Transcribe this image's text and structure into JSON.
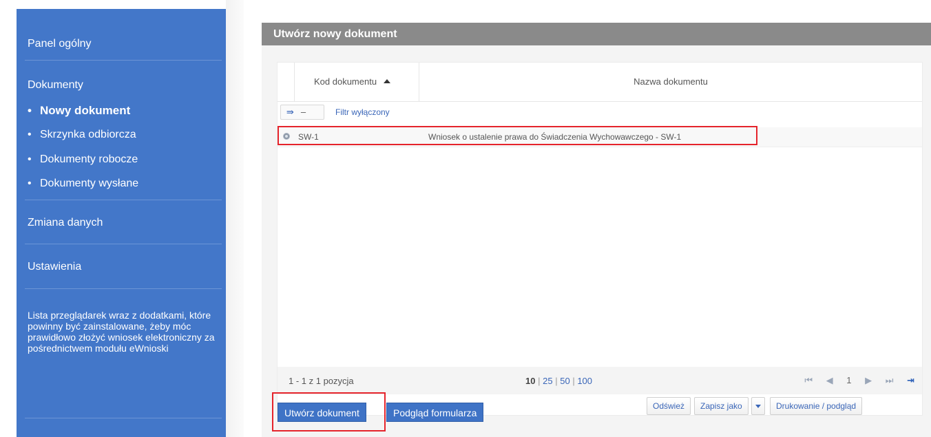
{
  "sidebar": {
    "panel": "Panel ogólny",
    "documents": "Dokumenty",
    "sub_items": [
      {
        "label": "Nowy dokument"
      },
      {
        "label": "Skrzynka odbiorcza"
      },
      {
        "label": "Dokumenty robocze"
      },
      {
        "label": "Dokumenty wysłane"
      }
    ],
    "bullet": "•",
    "change": "Zmiana danych",
    "settings": "Ustawienia",
    "note": "Lista przeglądarek wraz z dodatkami, które powinny być zainstalowane, żeby móc prawidłowo złożyć wniosek elektroniczny za pośrednictwem modułu eWnioski"
  },
  "panel": {
    "title": "Utwórz nowy dokument",
    "columns": {
      "code": "Kod dokumentu",
      "name": "Nazwa dokumentu"
    },
    "filter": {
      "icon": "⇛",
      "minus": "–",
      "status": "Filtr wyłączony"
    },
    "rows": [
      {
        "code": "SW-1",
        "name": "Wniosek o ustalenie prawa do Świadczenia Wychowawczego - SW-1"
      }
    ],
    "pager": {
      "info": "1 - 1 z 1 pozycja",
      "sizes": [
        "10",
        "25",
        "50",
        "100"
      ],
      "sep": "|",
      "first": "⏮",
      "prev": "◀",
      "page": "1",
      "next": "▶",
      "last_btn": "⏭",
      "end": "⇥"
    },
    "toolbar": {
      "refresh": "Odśwież",
      "save_as": "Zapisz jako",
      "print": "Drukowanie / podgląd"
    }
  },
  "actions": {
    "create": "Utwórz dokument",
    "preview": "Podgląd formularza"
  },
  "colors": {
    "sidebar_bg": "#4377c9",
    "title_bar": "#8a8a8a",
    "highlight": "#e5232b",
    "button_blue": "#3f73c6"
  }
}
